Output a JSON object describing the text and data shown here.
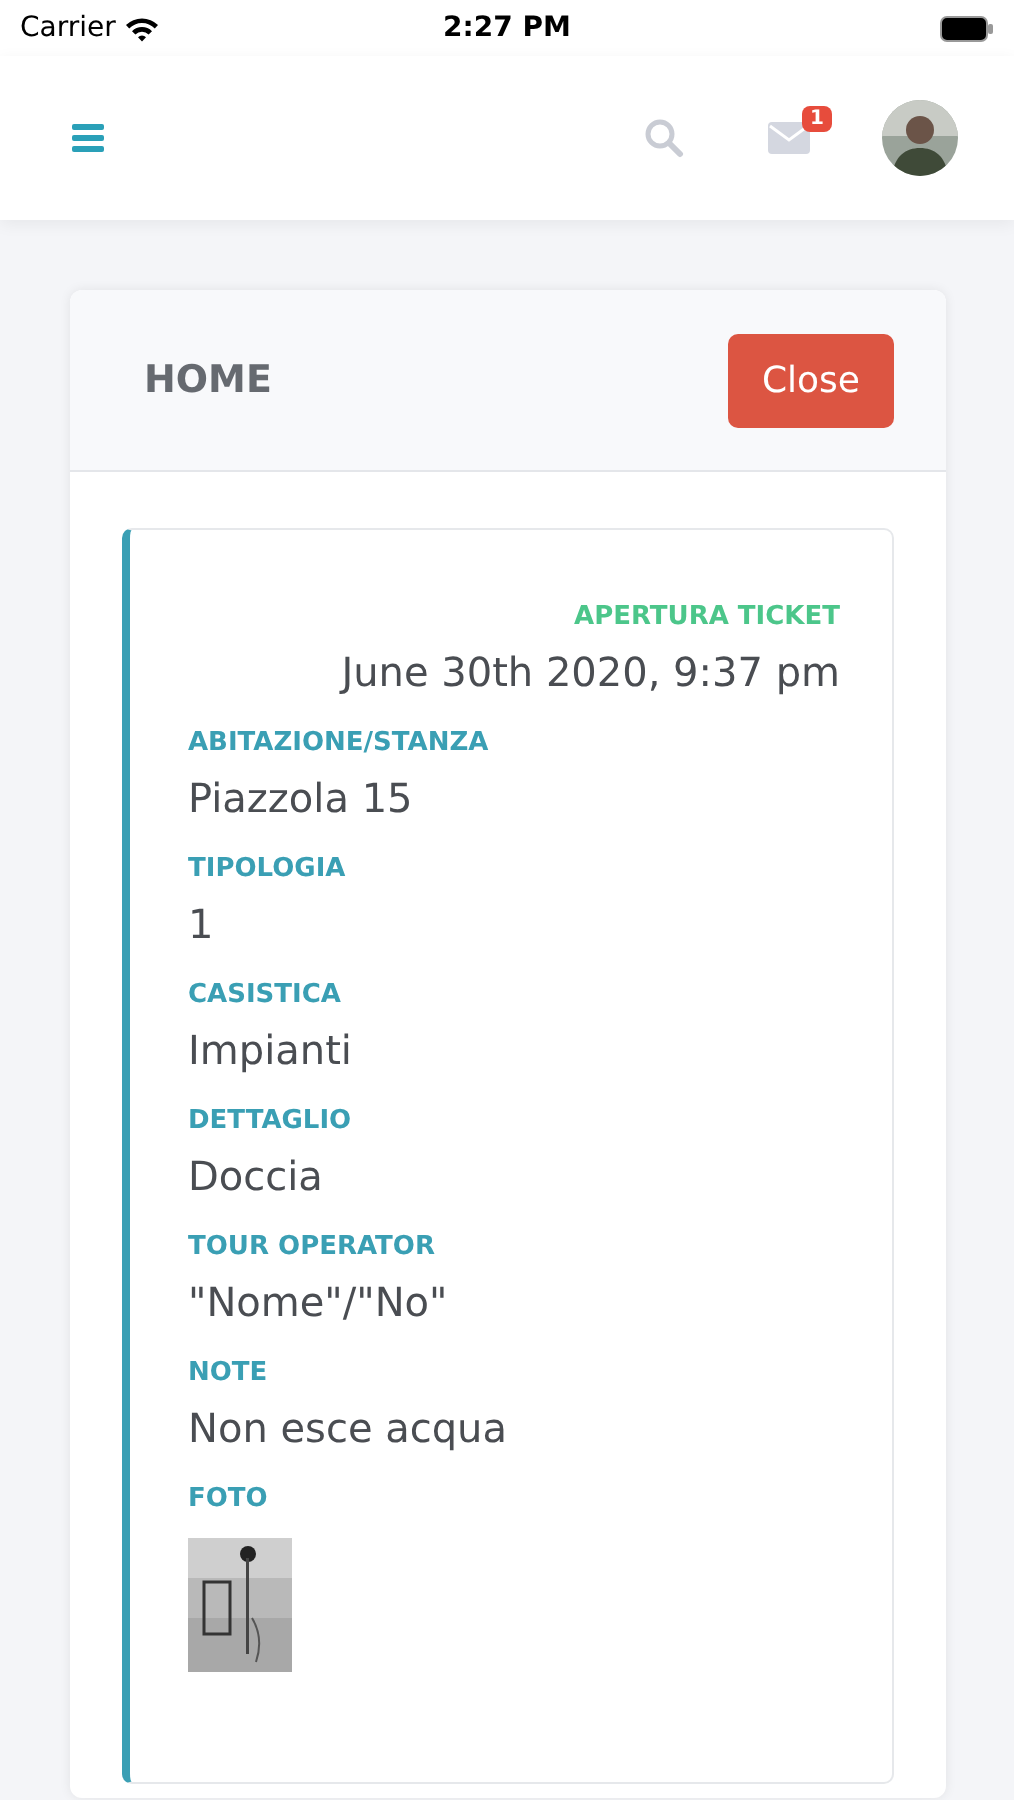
{
  "status_bar": {
    "carrier": "Carrier",
    "time": "2:27 PM"
  },
  "header": {
    "mail_badge": "1"
  },
  "panel": {
    "title": "HOME",
    "close_button": "Close"
  },
  "ticket": {
    "opened_label": "APERTURA TICKET",
    "opened_at": "June 30th 2020, 9:37 pm",
    "fields": [
      {
        "label": "ABITAZIONE/STANZA",
        "value": "Piazzola 15"
      },
      {
        "label": "TIPOLOGIA",
        "value": "1"
      },
      {
        "label": "CASISTICA",
        "value": "Impianti"
      },
      {
        "label": "DETTAGLIO",
        "value": "Doccia"
      },
      {
        "label": "TOUR OPERATOR",
        "value": "\"Nome\"/\"No\""
      },
      {
        "label": "NOTE",
        "value": "Non esce acqua"
      }
    ],
    "photo_label": "FOTO"
  }
}
